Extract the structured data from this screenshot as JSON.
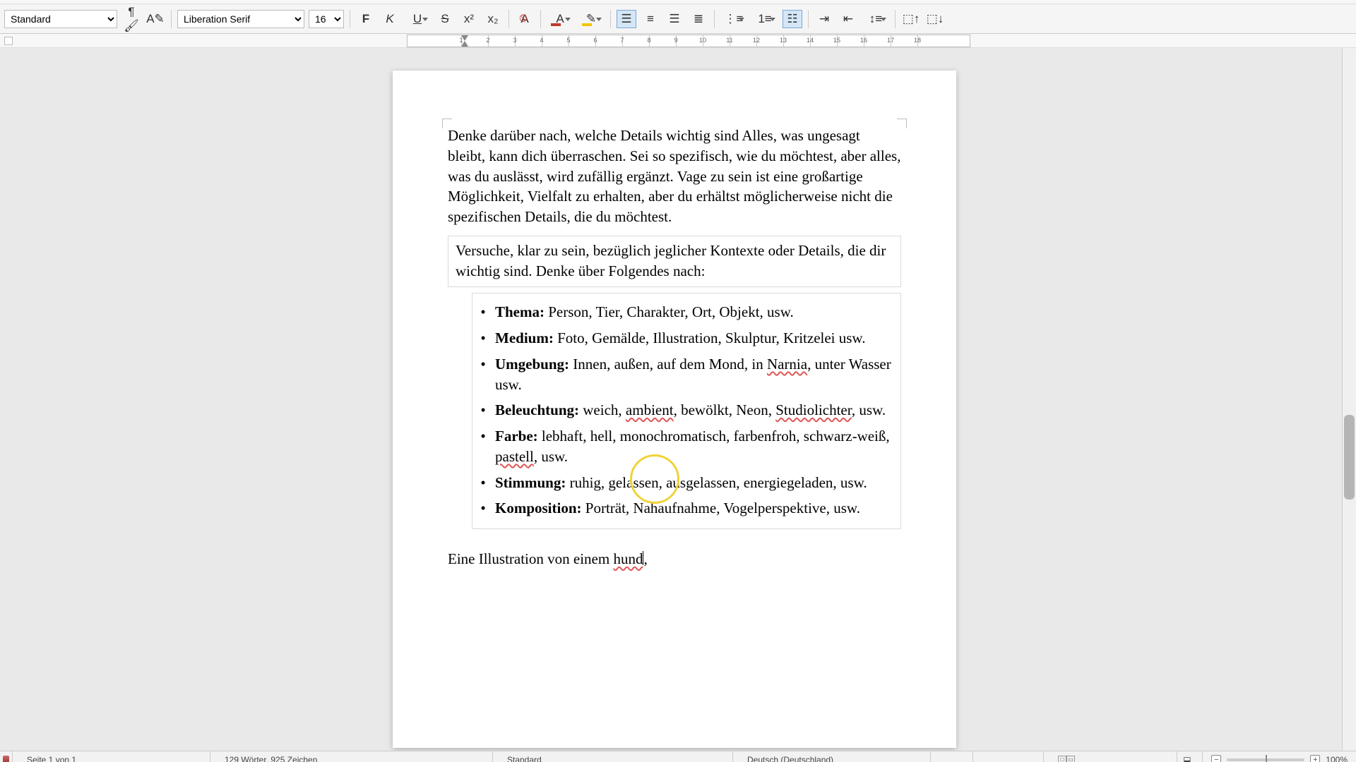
{
  "toolbar": {
    "style": "Standard",
    "font": "Liberation Serif",
    "size": "16 pt",
    "bold": "F",
    "italic": "K",
    "underline": "U",
    "strike": "S",
    "super": "x²",
    "sub": "x₂",
    "fontcolor_glyph": "A",
    "highlight_glyph": "✎",
    "fontcolor": "#c0392b",
    "highlight": "#f1c40f",
    "clear_glyph": "A⃠"
  },
  "ruler": {
    "labels": [
      "1",
      "2",
      "3",
      "4",
      "5",
      "6",
      "7",
      "8",
      "9",
      "10",
      "11",
      "12",
      "13",
      "14",
      "15",
      "16",
      "17",
      "18"
    ]
  },
  "doc": {
    "p1": "Denke darüber nach, welche Details wichtig sind Alles, was ungesagt bleibt, kann dich überraschen. Sei so spezifisch, wie du möchtest, aber alles, was du auslässt, wird zufällig ergänzt. Vage zu sein ist eine großartige Möglichkeit, Vielfalt zu erhalten, aber du erhältst möglicherweise nicht die spezifischen Details, die du möchtest.",
    "box_intro": "Versuche, klar zu sein, bezüglich jeglicher Kontexte oder Details, die dir wichtig sind. Denke über Folgendes nach:",
    "items": [
      {
        "label": "Thema:",
        "text_pre": " Person, Tier, Charakter, Ort, Objekt, usw.",
        "spells": []
      },
      {
        "label": "Medium:",
        "text_pre": " Foto, Gemälde, Illustration, Skulptur, Kritzelei usw.",
        "spells": []
      },
      {
        "label": "Umgebung:",
        "text_pre": " Innen, außen, auf dem Mond, in ",
        "spell1": "Narnia",
        "text_post": ", unter Wasser usw."
      },
      {
        "label": "Beleuchtung:",
        "text_pre": " weich, ",
        "spell1": "ambient",
        "text_mid": ", bewölkt, Neon, ",
        "spell2": "Studiolichter",
        "text_post": ", usw."
      },
      {
        "label": "Farbe:",
        "text_pre": " lebhaft, hell, monochromatisch, farbenfroh, schwarz-weiß, ",
        "spell1": "pastell",
        "text_post": ", usw."
      },
      {
        "label": "Stimmung:",
        "text_pre": " ruhig, gelassen, ausgelassen, energiegeladen, usw.",
        "spells": []
      },
      {
        "label": "Komposition:",
        "text_pre": " Porträt, Nahaufnahme, Vogelperspektive, usw.",
        "spells": []
      }
    ],
    "line2_pre": "Eine Illustration von einem ",
    "line2_spell": "hund",
    "line2_post": ","
  },
  "status": {
    "page": "Seite 1 von 1",
    "words": "129 Wörter, 925 Zeichen",
    "stylecell": "Standard",
    "lang": "Deutsch (Deutschland)",
    "zoom": "100%"
  }
}
